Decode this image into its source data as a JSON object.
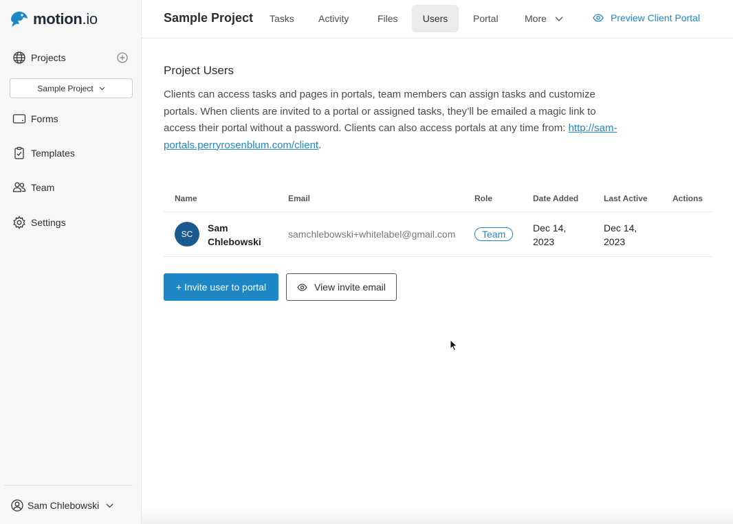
{
  "brand": {
    "name_bold": "motion",
    "name_light": ".io",
    "color": "#1e88c7"
  },
  "sidebar": {
    "projects_label": "Projects",
    "project_selector": "Sample Project",
    "items": [
      {
        "label": "Forms",
        "icon": "tablet-icon"
      },
      {
        "label": "Templates",
        "icon": "clipboard-check-icon"
      },
      {
        "label": "Team",
        "icon": "users-icon"
      },
      {
        "label": "Settings",
        "icon": "gear-icon"
      }
    ],
    "user_name": "Sam Chlebowski"
  },
  "topbar": {
    "project_title": "Sample Project",
    "tabs": [
      {
        "label": "Tasks"
      },
      {
        "label": "Activity"
      },
      {
        "label": "Files"
      },
      {
        "label": "Users",
        "active": true
      },
      {
        "label": "Portal"
      },
      {
        "label": "More"
      }
    ],
    "preview_label": "Preview Client Portal"
  },
  "main": {
    "title": "Project Users",
    "description": "Clients can access tasks and pages in portals, team members can assign tasks and customize portals. When clients are invited to a portal or assigned tasks, they’ll be emailed a magic link to access their portal without a password. Clients can also access portals at any time from: ",
    "portal_link": "http://sam-portals.perryrosenblum.com/client",
    "description_end": ".",
    "table": {
      "headers": {
        "name": "Name",
        "email": "Email",
        "role": "Role",
        "date_added": "Date Added",
        "last_active": "Last Active",
        "actions": "Actions"
      },
      "rows": [
        {
          "initials": "SC",
          "name": "Sam Chlebowski",
          "email": "samchlebowski+whitelabel@gmail.com",
          "role": "Team",
          "date_added": "Dec 14, 2023",
          "last_active": "Dec 14, 2023"
        }
      ]
    },
    "invite_button": "+ Invite user to portal",
    "view_invite_button": "View invite email"
  }
}
